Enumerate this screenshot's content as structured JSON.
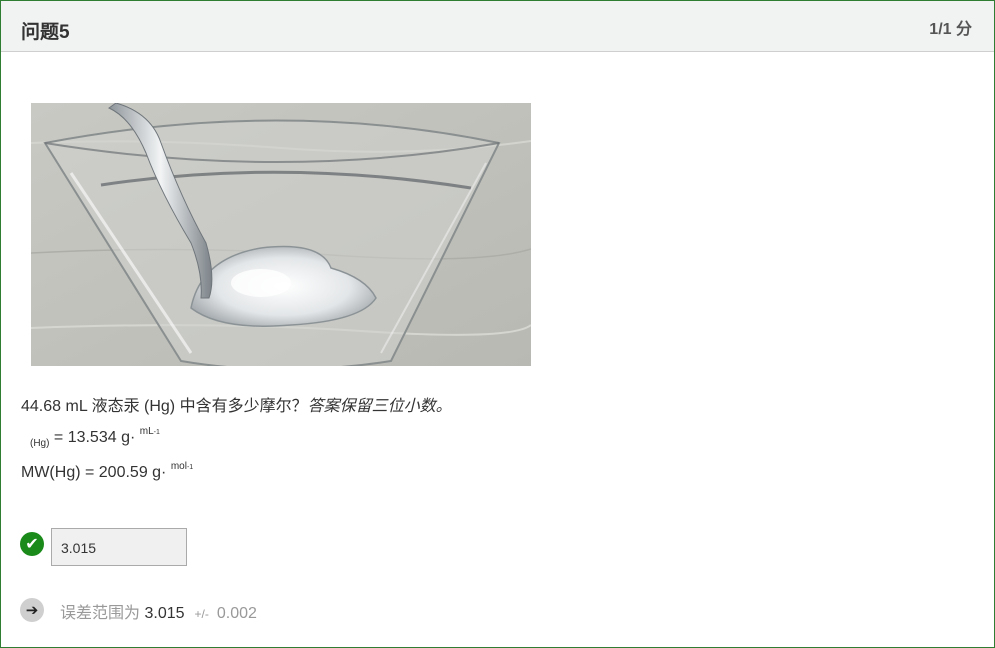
{
  "header": {
    "title": "问题5",
    "score": "1/1 分"
  },
  "question": {
    "text": "44.68 mL 液态汞 (Hg) 中含有多少摩尔？",
    "instruction": "答案保留三位小数。",
    "density": {
      "subscript": "(Hg)",
      "value": " = 13.534 g·",
      "unit": "mL",
      "exponent": "-1"
    },
    "molar_mass": {
      "label": "MW(Hg) = 200.59 g·",
      "unit": "mol",
      "exponent": "-1"
    }
  },
  "answer": {
    "value": "3.015",
    "status_icon": "check-circle-icon"
  },
  "feedback": {
    "label": "误差范围为",
    "value": "3.015",
    "plusminus": "+/-",
    "tolerance": "0.002",
    "icon": "arrow-right-circle-icon"
  },
  "colors": {
    "frame_border": "#2e7d32",
    "header_bg": "#f1f2f2",
    "correct": "#1a8a1a"
  }
}
